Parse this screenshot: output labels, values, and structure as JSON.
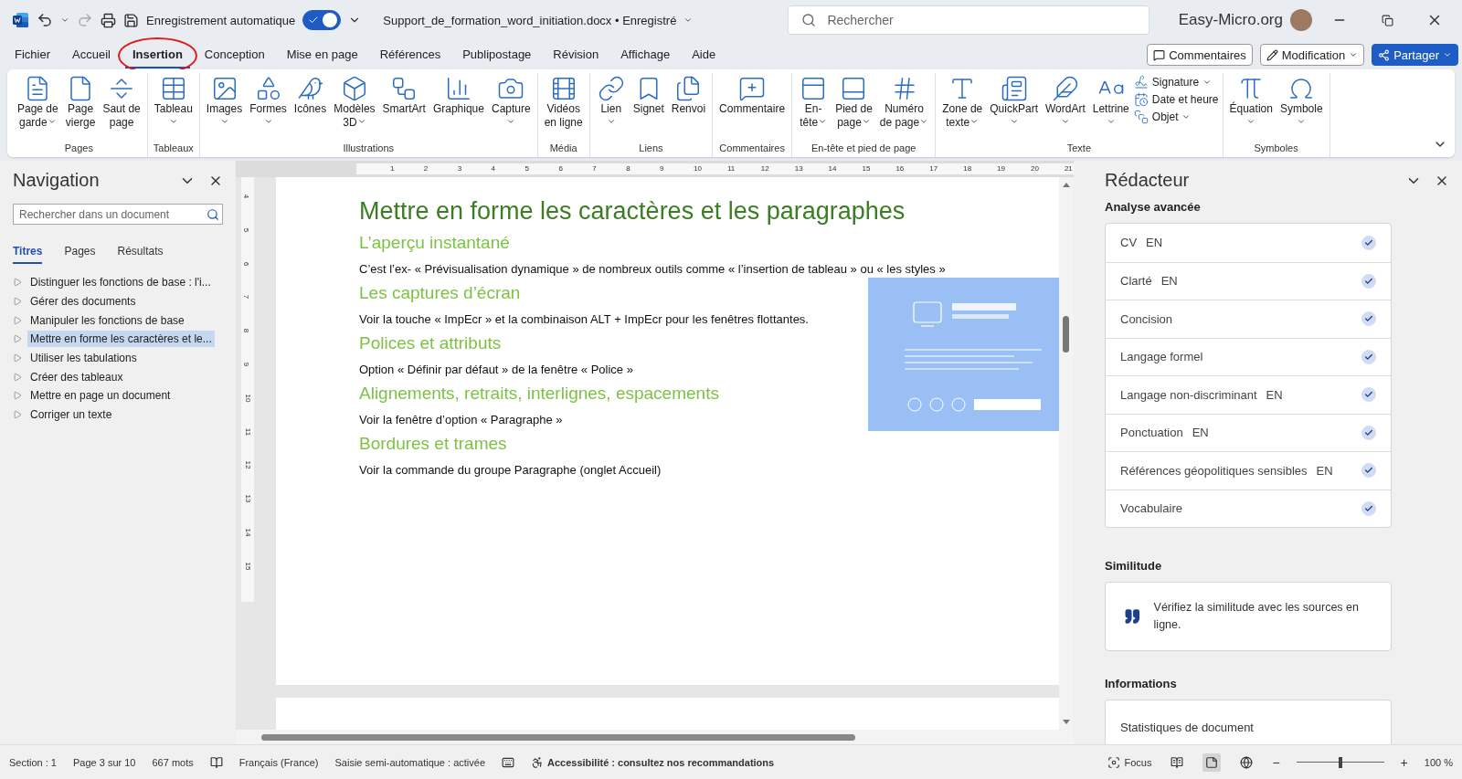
{
  "title_bar": {
    "autosave_label": "Enregistrement automatique",
    "autosave_on": true,
    "file_name": "Support_de_formation_word_initiation.docx • Enregistré",
    "search_placeholder": "Rechercher",
    "account": "Easy-Micro.org"
  },
  "menu_tabs": [
    {
      "label": "Fichier",
      "selected": false,
      "circled": false
    },
    {
      "label": "Accueil",
      "selected": false,
      "circled": false
    },
    {
      "label": "Insertion",
      "selected": true,
      "circled": true
    },
    {
      "label": "Conception",
      "selected": false,
      "circled": false
    },
    {
      "label": "Mise en page",
      "selected": false,
      "circled": false
    },
    {
      "label": "Références",
      "selected": false,
      "circled": false
    },
    {
      "label": "Publipostage",
      "selected": false,
      "circled": false
    },
    {
      "label": "Révision",
      "selected": false,
      "circled": false
    },
    {
      "label": "Affichage",
      "selected": false,
      "circled": false
    },
    {
      "label": "Aide",
      "selected": false,
      "circled": false
    }
  ],
  "ribbon_buttons": {
    "comments": "Commentaires",
    "editing": "Modification",
    "share": "Partager"
  },
  "ribbon_groups": [
    {
      "label": "Pages",
      "items": [
        {
          "kind": "large",
          "lines": [
            "Page de",
            "garde"
          ],
          "dropdown": true
        },
        {
          "kind": "large",
          "lines": [
            "Page",
            "vierge"
          ],
          "dropdown": false
        },
        {
          "kind": "large",
          "lines": [
            "Saut de",
            "page"
          ],
          "dropdown": false
        }
      ]
    },
    {
      "label": "Tableaux",
      "items": [
        {
          "kind": "large",
          "lines": [
            "Tableau"
          ],
          "dropdown": true
        }
      ]
    },
    {
      "label": "Illustrations",
      "items": [
        {
          "kind": "large",
          "lines": [
            "Images"
          ],
          "dropdown": true
        },
        {
          "kind": "large",
          "lines": [
            "Formes"
          ],
          "dropdown": true
        },
        {
          "kind": "large",
          "lines": [
            "Icônes"
          ],
          "dropdown": false
        },
        {
          "kind": "large",
          "lines": [
            "Modèles",
            "3D"
          ],
          "dropdown": true
        },
        {
          "kind": "large",
          "lines": [
            "SmartArt"
          ],
          "dropdown": false
        },
        {
          "kind": "large",
          "lines": [
            "Graphique"
          ],
          "dropdown": false
        },
        {
          "kind": "large",
          "lines": [
            "Capture"
          ],
          "dropdown": true
        }
      ]
    },
    {
      "label": "Média",
      "items": [
        {
          "kind": "large",
          "lines": [
            "Vidéos",
            "en ligne"
          ],
          "dropdown": false
        }
      ]
    },
    {
      "label": "Liens",
      "items": [
        {
          "kind": "large",
          "lines": [
            "Lien"
          ],
          "dropdown": true
        },
        {
          "kind": "large",
          "lines": [
            "Signet"
          ],
          "dropdown": false
        },
        {
          "kind": "large",
          "lines": [
            "Renvoi"
          ],
          "dropdown": false
        }
      ]
    },
    {
      "label": "Commentaires",
      "items": [
        {
          "kind": "large",
          "lines": [
            "Commentaire"
          ],
          "dropdown": false
        }
      ]
    },
    {
      "label": "En-tête et pied de page",
      "items": [
        {
          "kind": "large",
          "lines": [
            "En-",
            "tête"
          ],
          "dropdown": true
        },
        {
          "kind": "large",
          "lines": [
            "Pied de",
            "page"
          ],
          "dropdown": true
        },
        {
          "kind": "large",
          "lines": [
            "Numéro",
            "de page"
          ],
          "dropdown": true
        }
      ]
    },
    {
      "label": "Texte",
      "items": [
        {
          "kind": "large",
          "lines": [
            "Zone de",
            "texte"
          ],
          "dropdown": true
        },
        {
          "kind": "large",
          "lines": [
            "QuickPart"
          ],
          "dropdown": true
        },
        {
          "kind": "large",
          "lines": [
            "WordArt"
          ],
          "dropdown": true
        },
        {
          "kind": "large",
          "lines": [
            "Lettrine"
          ],
          "dropdown": true
        },
        {
          "kind": "small",
          "lines": [
            "Signature"
          ],
          "dropdown": true
        },
        {
          "kind": "small",
          "lines": [
            "Date et heure"
          ],
          "dropdown": false
        },
        {
          "kind": "small",
          "lines": [
            "Objet"
          ],
          "dropdown": true
        }
      ]
    },
    {
      "label": "Symboles",
      "items": [
        {
          "kind": "large",
          "lines": [
            "Équation"
          ],
          "dropdown": true
        },
        {
          "kind": "large",
          "lines": [
            "Symbole"
          ],
          "dropdown": true
        }
      ]
    }
  ],
  "navigation": {
    "title": "Navigation",
    "search_placeholder": "Rechercher dans un document",
    "tabs": [
      {
        "label": "Titres",
        "selected": true
      },
      {
        "label": "Pages",
        "selected": false
      },
      {
        "label": "Résultats",
        "selected": false
      }
    ],
    "headings": [
      {
        "label": "Distinguer les fonctions de base : l'i...",
        "expanded": false,
        "selected": false
      },
      {
        "label": "Gérer des documents",
        "expanded": false,
        "selected": false
      },
      {
        "label": "Manipuler les fonctions de base",
        "expanded": false,
        "selected": false
      },
      {
        "label": "Mettre en forme les caractères et le...",
        "expanded": false,
        "selected": true
      },
      {
        "label": "Utiliser les tabulations",
        "expanded": false,
        "selected": false
      },
      {
        "label": "Créer des tableaux",
        "expanded": false,
        "selected": false
      },
      {
        "label": "Mettre en page un document",
        "expanded": false,
        "selected": false
      },
      {
        "label": "Corriger un texte",
        "expanded": false,
        "selected": false
      }
    ]
  },
  "rulers": {
    "horizontal": [
      "1",
      "2",
      "3",
      "4",
      "5",
      "6",
      "7",
      "8",
      "9",
      "10",
      "11",
      "12",
      "13",
      "14",
      "15",
      "16",
      "17",
      "18",
      "19",
      "20",
      "21"
    ],
    "vertical": [
      "4",
      "5",
      "6",
      "7",
      "8",
      "9",
      "10",
      "11",
      "12",
      "13",
      "14",
      "15"
    ]
  },
  "document": {
    "title": "Mettre en forme les caractères et les paragraphes",
    "sections": [
      {
        "heading": "L’aperçu instantané",
        "text": "C’est l’ex- « Prévisualisation dynamique » de nombreux outils comme « l’insertion de tableau » ou « les styles »"
      },
      {
        "heading": "Les captures d’écran",
        "text": "Voir la touche « ImpEcr » et la combinaison ALT + ImpEcr pour les fenêtres flottantes."
      },
      {
        "heading": "Polices et attributs",
        "text": "Option « Définir par défaut » de la fenêtre « Police »"
      },
      {
        "heading": "Alignements, retraits, interlignes, espacements",
        "text": "Voir la fenêtre d’option « Paragraphe »"
      },
      {
        "heading": "Bordures et trames",
        "text": "Voir la commande du groupe Paragraphe (onglet Accueil)"
      }
    ]
  },
  "editor": {
    "title": "Rédacteur",
    "analysis_heading": "Analyse avancée",
    "checks": [
      {
        "label": "CV",
        "tag": "EN",
        "checked": true
      },
      {
        "label": "Clarté",
        "tag": "EN",
        "checked": true
      },
      {
        "label": "Concision",
        "checked": true
      },
      {
        "label": "Langage formel",
        "checked": true
      },
      {
        "label": "Langage non-discriminant",
        "tag": "EN",
        "checked": true
      },
      {
        "label": "Ponctuation",
        "tag": "EN",
        "checked": true
      },
      {
        "label": "Références géopolitiques sensibles",
        "tag": "EN",
        "checked": true
      },
      {
        "label": "Vocabulaire",
        "checked": true
      }
    ],
    "similarity_heading": "Similitude",
    "similarity_text": "Vérifiez la similitude avec les sources en ligne.",
    "info_heading": "Informations",
    "info_items": [
      "Statistiques de document"
    ]
  },
  "status_bar": {
    "section": "Section : 1",
    "page": "Page 3 sur 10",
    "words": "667 mots",
    "language": "Français (France)",
    "autocomplete": "Saisie semi-automatique : activée",
    "accessibility": "Accessibilité : consultez nos recommandations",
    "focus": "Focus",
    "views": [
      {
        "selected": false
      },
      {
        "selected": true
      },
      {
        "selected": false
      }
    ],
    "zoom_out": "−",
    "zoom_in": "+",
    "zoom": {
      "level": 0.5,
      "reading": "100 %"
    }
  }
}
